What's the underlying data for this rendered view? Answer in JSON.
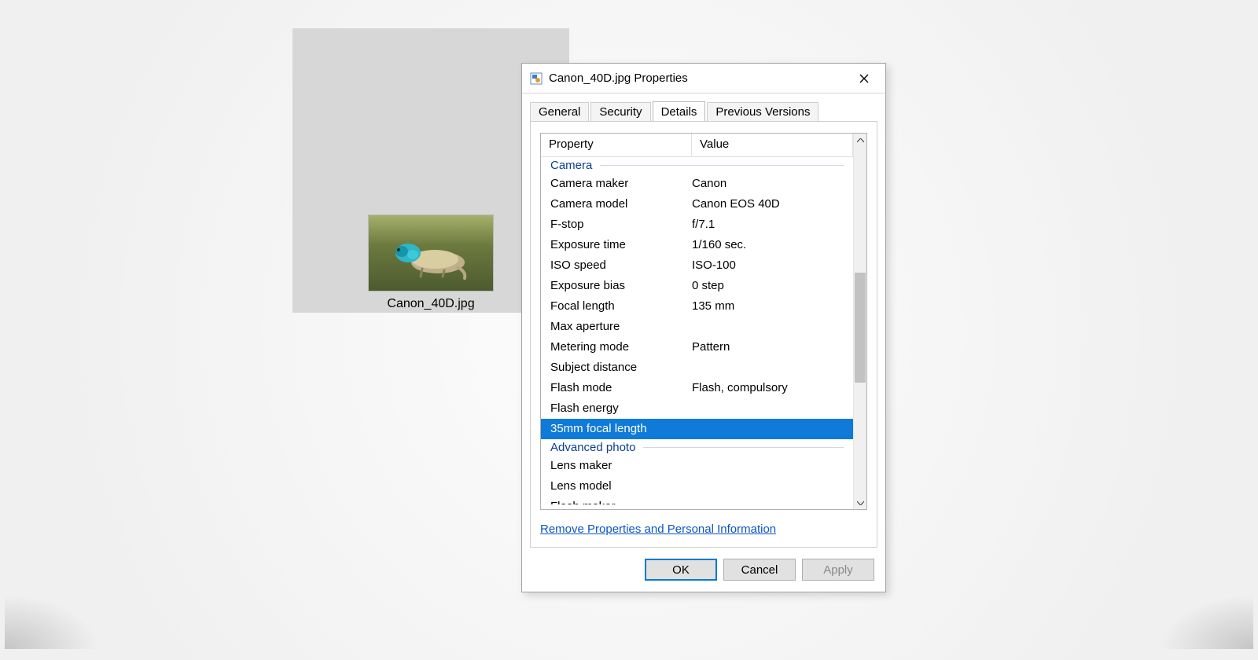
{
  "file": {
    "name": "Canon_40D.jpg"
  },
  "dialog": {
    "title": "Canon_40D.jpg Properties",
    "tabs": {
      "general": "General",
      "security": "Security",
      "details": "Details",
      "previous": "Previous Versions"
    },
    "columns": {
      "property": "Property",
      "value": "Value"
    },
    "sections": {
      "camera": "Camera",
      "advanced": "Advanced photo"
    },
    "rows": {
      "camera_maker": {
        "p": "Camera maker",
        "v": "Canon"
      },
      "camera_model": {
        "p": "Camera model",
        "v": "Canon EOS 40D"
      },
      "f_stop": {
        "p": "F-stop",
        "v": "f/7.1"
      },
      "exposure_time": {
        "p": "Exposure time",
        "v": "1/160 sec."
      },
      "iso_speed": {
        "p": "ISO speed",
        "v": "ISO-100"
      },
      "exposure_bias": {
        "p": "Exposure bias",
        "v": "0 step"
      },
      "focal_length": {
        "p": "Focal length",
        "v": "135 mm"
      },
      "max_aperture": {
        "p": "Max aperture",
        "v": ""
      },
      "metering_mode": {
        "p": "Metering mode",
        "v": "Pattern"
      },
      "subject_distance": {
        "p": "Subject distance",
        "v": ""
      },
      "flash_mode": {
        "p": "Flash mode",
        "v": "Flash, compulsory"
      },
      "flash_energy": {
        "p": "Flash energy",
        "v": ""
      },
      "focal_35mm": {
        "p": "35mm focal length",
        "v": ""
      },
      "lens_maker": {
        "p": "Lens maker",
        "v": ""
      },
      "lens_model": {
        "p": "Lens model",
        "v": ""
      },
      "flash_maker": {
        "p": "Flash maker",
        "v": ""
      }
    },
    "remove_link": "Remove Properties and Personal Information",
    "buttons": {
      "ok": "OK",
      "cancel": "Cancel",
      "apply": "Apply"
    }
  }
}
